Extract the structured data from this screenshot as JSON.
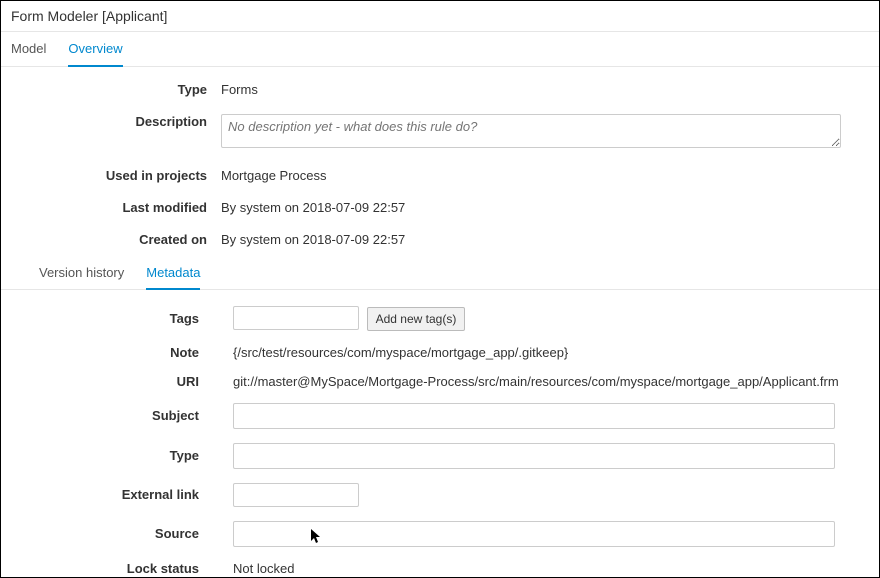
{
  "header": {
    "title": "Form Modeler [Applicant]"
  },
  "tabs": {
    "model": "Model",
    "overview": "Overview"
  },
  "overview": {
    "label_type": "Type",
    "type_value": "Forms",
    "label_description": "Description",
    "description_placeholder": "No description yet - what does this rule do?",
    "label_used_in_projects": "Used in projects",
    "used_in_projects_value": "Mortgage Process",
    "label_last_modified": "Last modified",
    "last_modified_value": "By system on 2018-07-09 22:57",
    "label_created_on": "Created on",
    "created_on_value": "By system on 2018-07-09 22:57"
  },
  "subtabs": {
    "version_history": "Version history",
    "metadata": "Metadata"
  },
  "metadata": {
    "label_tags": "Tags",
    "add_tag_button": "Add new tag(s)",
    "label_note": "Note",
    "note_value": "{/src/test/resources/com/myspace/mortgage_app/.gitkeep}",
    "label_uri": "URI",
    "uri_value": "git://master@MySpace/Mortgage-Process/src/main/resources/com/myspace/mortgage_app/Applicant.frm",
    "label_subject": "Subject",
    "label_type": "Type",
    "label_external_link": "External link",
    "label_source": "Source",
    "label_lock_status": "Lock status",
    "lock_status_value": "Not locked"
  }
}
